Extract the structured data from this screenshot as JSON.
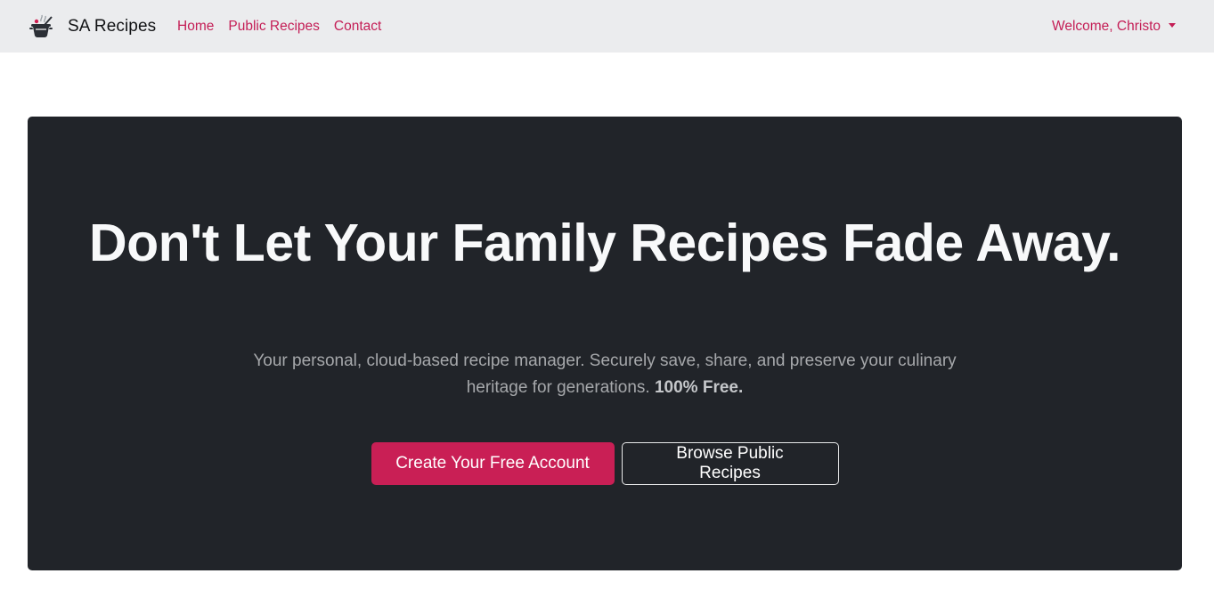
{
  "navbar": {
    "brand": {
      "name": "SA Recipes",
      "icon": "cooking-pot-icon"
    },
    "links": [
      {
        "label": "Home"
      },
      {
        "label": "Public Recipes"
      },
      {
        "label": "Contact"
      }
    ],
    "user_menu": {
      "label": "Welcome, Christo",
      "icon": "caret-down-icon"
    }
  },
  "hero": {
    "title": "Don't Let Your Family Recipes Fade Away.",
    "text": "Your personal, cloud-based recipe manager. Securely save, share, and preserve your culinary heritage for generations.",
    "text_emphasis": "100% Free.",
    "primary_button": "Create Your Free Account",
    "secondary_button": "Browse Public Recipes"
  },
  "colors": {
    "accent": "#c91f55",
    "navbar_bg": "#ebecee",
    "hero_bg": "#212429"
  }
}
